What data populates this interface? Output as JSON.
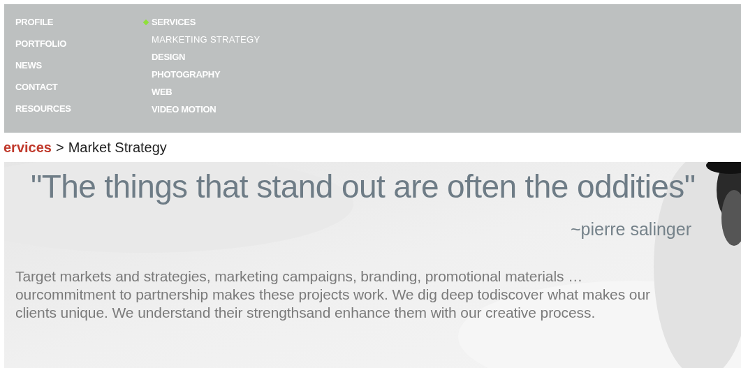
{
  "nav": {
    "main": [
      {
        "label": "PROFILE",
        "selected": false
      },
      {
        "label": "PORTFOLIO",
        "selected": false
      },
      {
        "label": "NEWS",
        "selected": false
      },
      {
        "label": "CONTACT",
        "selected": false
      },
      {
        "label": "RESOURCES",
        "selected": false
      }
    ],
    "section": {
      "label": "SERVICES",
      "selected": true,
      "children": [
        {
          "label": "MARKETING STRATEGY",
          "selected": true
        },
        {
          "label": "DESIGN",
          "selected": false
        },
        {
          "label": "PHOTOGRAPHY",
          "selected": false
        },
        {
          "label": "WEB",
          "selected": false
        },
        {
          "label": "VIDEO MOTION",
          "selected": false
        }
      ]
    }
  },
  "breadcrumb": {
    "section": "ervices",
    "separator": ">",
    "current": "Market Strategy"
  },
  "hero": {
    "kind": "picture",
    "quote": "\"The things that stand out are often the oddities\"",
    "attribution": "~pierre salinger",
    "body": "Target markets and strategies, marketing campaigns, branding, promotional materials …\nourcommitment to partnership makes these projects work. We dig deep todiscover what makes our\nclients unique. We understand their strengthsand enhance them with our creative process."
  }
}
